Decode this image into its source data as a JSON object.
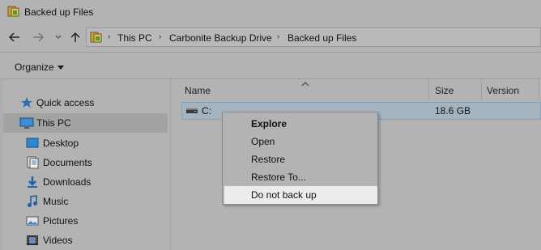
{
  "window": {
    "title": "Backed up Files",
    "app_icon": "folder-icon"
  },
  "nav": {
    "back_icon": "back-arrow-icon",
    "forward_icon": "forward-arrow-icon",
    "recent_icon": "chevron-down-icon",
    "up_icon": "up-arrow-icon"
  },
  "address": {
    "crumbs": [
      "This PC",
      "Carbonite Backup Drive",
      "Backed up Files"
    ],
    "separator": "›"
  },
  "toolbar": {
    "organize_label": "Organize"
  },
  "navpane": {
    "items": [
      {
        "label": "Quick access",
        "icon": "star-icon"
      },
      {
        "label": "This PC",
        "icon": "computer-icon",
        "selected": true
      },
      {
        "label": "Desktop",
        "icon": "desktop-icon"
      },
      {
        "label": "Documents",
        "icon": "documents-icon"
      },
      {
        "label": "Downloads",
        "icon": "downloads-icon"
      },
      {
        "label": "Music",
        "icon": "music-icon"
      },
      {
        "label": "Pictures",
        "icon": "pictures-icon"
      },
      {
        "label": "Videos",
        "icon": "videos-icon"
      }
    ]
  },
  "filelist": {
    "columns": [
      "Name",
      "Size",
      "Version"
    ],
    "rows": [
      {
        "name": "C:",
        "size": "18.6 GB",
        "version": "",
        "icon": "drive-icon"
      }
    ]
  },
  "context_menu": {
    "items": [
      "Explore",
      "Open",
      "Restore",
      "Restore To...",
      "Do not back up"
    ],
    "highlighted": "Do not back up"
  },
  "colors": {
    "background": "#b3b3b3",
    "selection": "#a4b3c0",
    "menu_highlight": "#ececec"
  }
}
